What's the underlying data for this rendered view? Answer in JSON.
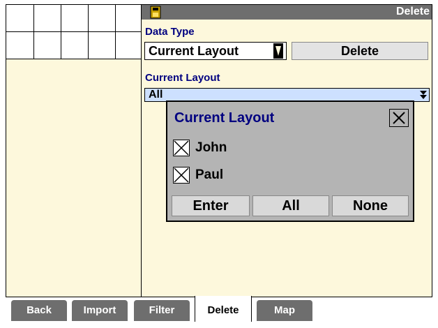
{
  "header": {
    "title": "Delete"
  },
  "data_type": {
    "label": "Data Type",
    "value": "Current Layout"
  },
  "delete_button": {
    "label": "Delete"
  },
  "current_layout": {
    "label": "Current Layout",
    "value": "All"
  },
  "dialog": {
    "title": "Current Layout",
    "items": [
      {
        "label": "John",
        "checked": true
      },
      {
        "label": "Paul",
        "checked": true
      }
    ],
    "buttons": {
      "enter": "Enter",
      "all": "All",
      "none": "None"
    }
  },
  "tabs": [
    {
      "label": "Back"
    },
    {
      "label": "Import"
    },
    {
      "label": "Filter"
    },
    {
      "label": "Delete",
      "active": true
    },
    {
      "label": "Map"
    }
  ],
  "colors": {
    "header_bg": "#6e6e6e",
    "panel_bg": "#fdf8dc",
    "label_color": "#000080",
    "select_bg": "#cde0ff",
    "dialog_bg": "#b4b4b4"
  }
}
